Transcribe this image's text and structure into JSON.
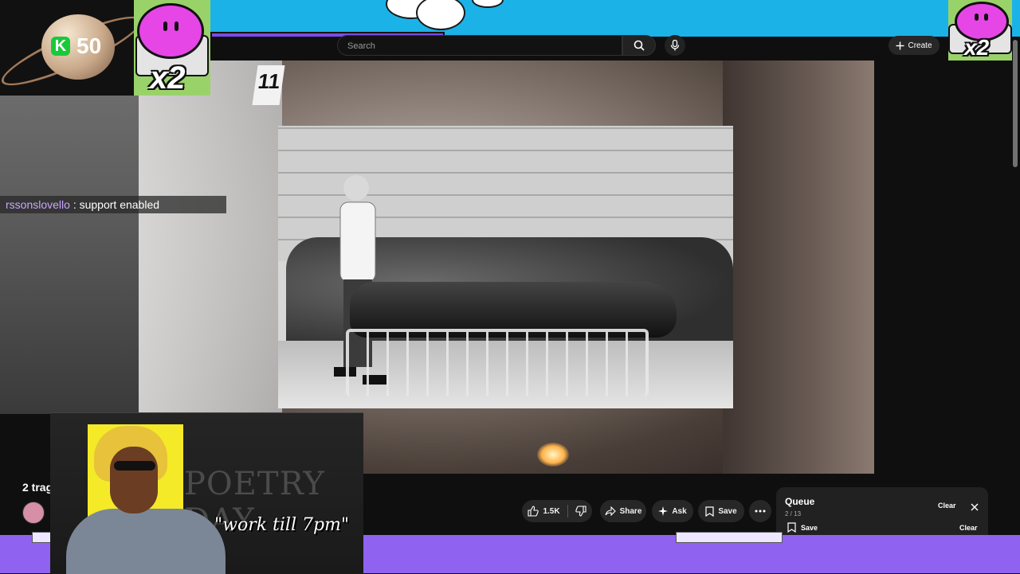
{
  "header": {
    "search_placeholder": "Search",
    "create_label": "Create"
  },
  "overlay": {
    "points_badge": "K",
    "points_value": "50",
    "multiplier_left": "x2",
    "multiplier_right": "x2",
    "evidence_marker": "11",
    "chat": {
      "username": "rssonslovello",
      "message": " : support enabled"
    },
    "webcam_caption": "\"work till 7pm\"",
    "chalkboard_text": "POETRY DAY"
  },
  "video": {
    "title_fragment": "2 trag",
    "likes": "1.5K",
    "share_label": "Share",
    "ask_label": "Ask",
    "save_label": "Save"
  },
  "queue": {
    "title": "Queue",
    "position": "2 / 13",
    "clear_label": "Clear",
    "save_label": "Save",
    "clear_label_2": "Clear"
  },
  "colors": {
    "sky": "#1bb2e8",
    "purple_band": "#8f63ef",
    "chat_username": "#c9a7ff",
    "kick_green": "#19c93a",
    "youtube_bg": "#0f0f0f"
  }
}
